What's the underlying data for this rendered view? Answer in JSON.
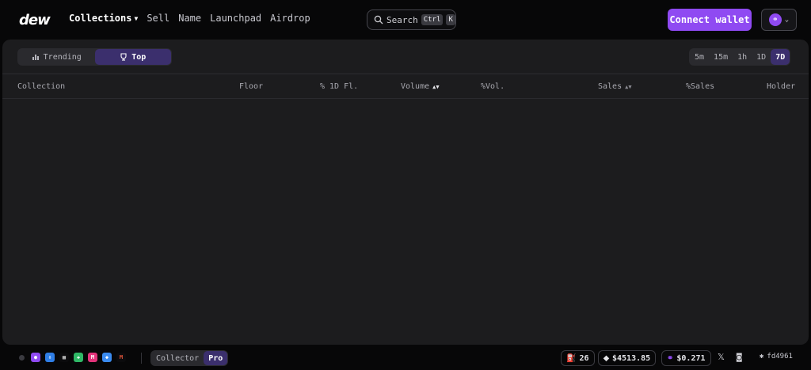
{
  "brand": {
    "logo_text": "dew"
  },
  "nav": {
    "items": [
      {
        "label": "Collections",
        "active": true
      },
      {
        "label": "Sell"
      },
      {
        "label": "Name"
      },
      {
        "label": "Launchpad"
      },
      {
        "label": "Airdrop"
      }
    ]
  },
  "search": {
    "label": "Search",
    "kbd1": "Ctrl",
    "kbd2": "K"
  },
  "header": {
    "connect_label": "Connect wallet"
  },
  "view_toggle": {
    "trending": "Trending",
    "top": "Top",
    "active": "Top"
  },
  "timeframes": {
    "items": [
      "5m",
      "15m",
      "1h",
      "1D",
      "7D"
    ],
    "active": "7D"
  },
  "table": {
    "columns": [
      "Collection",
      "Floor",
      "% 1D Fl.",
      "Volume",
      "%Vol.",
      "Sales",
      "%Sales",
      "Holder"
    ],
    "sorted_by": "Volume",
    "rows": []
  },
  "footer": {
    "mode": {
      "collector": "Collector",
      "pro": "Pro",
      "active": "Pro"
    },
    "gas": "26",
    "eth_price": "$4513.85",
    "token_price": "$0.271",
    "wallet_short": "fd4961"
  },
  "colors": {
    "accent": "#8f4af2",
    "panel": "#1c1c1e",
    "background": "#070708"
  }
}
